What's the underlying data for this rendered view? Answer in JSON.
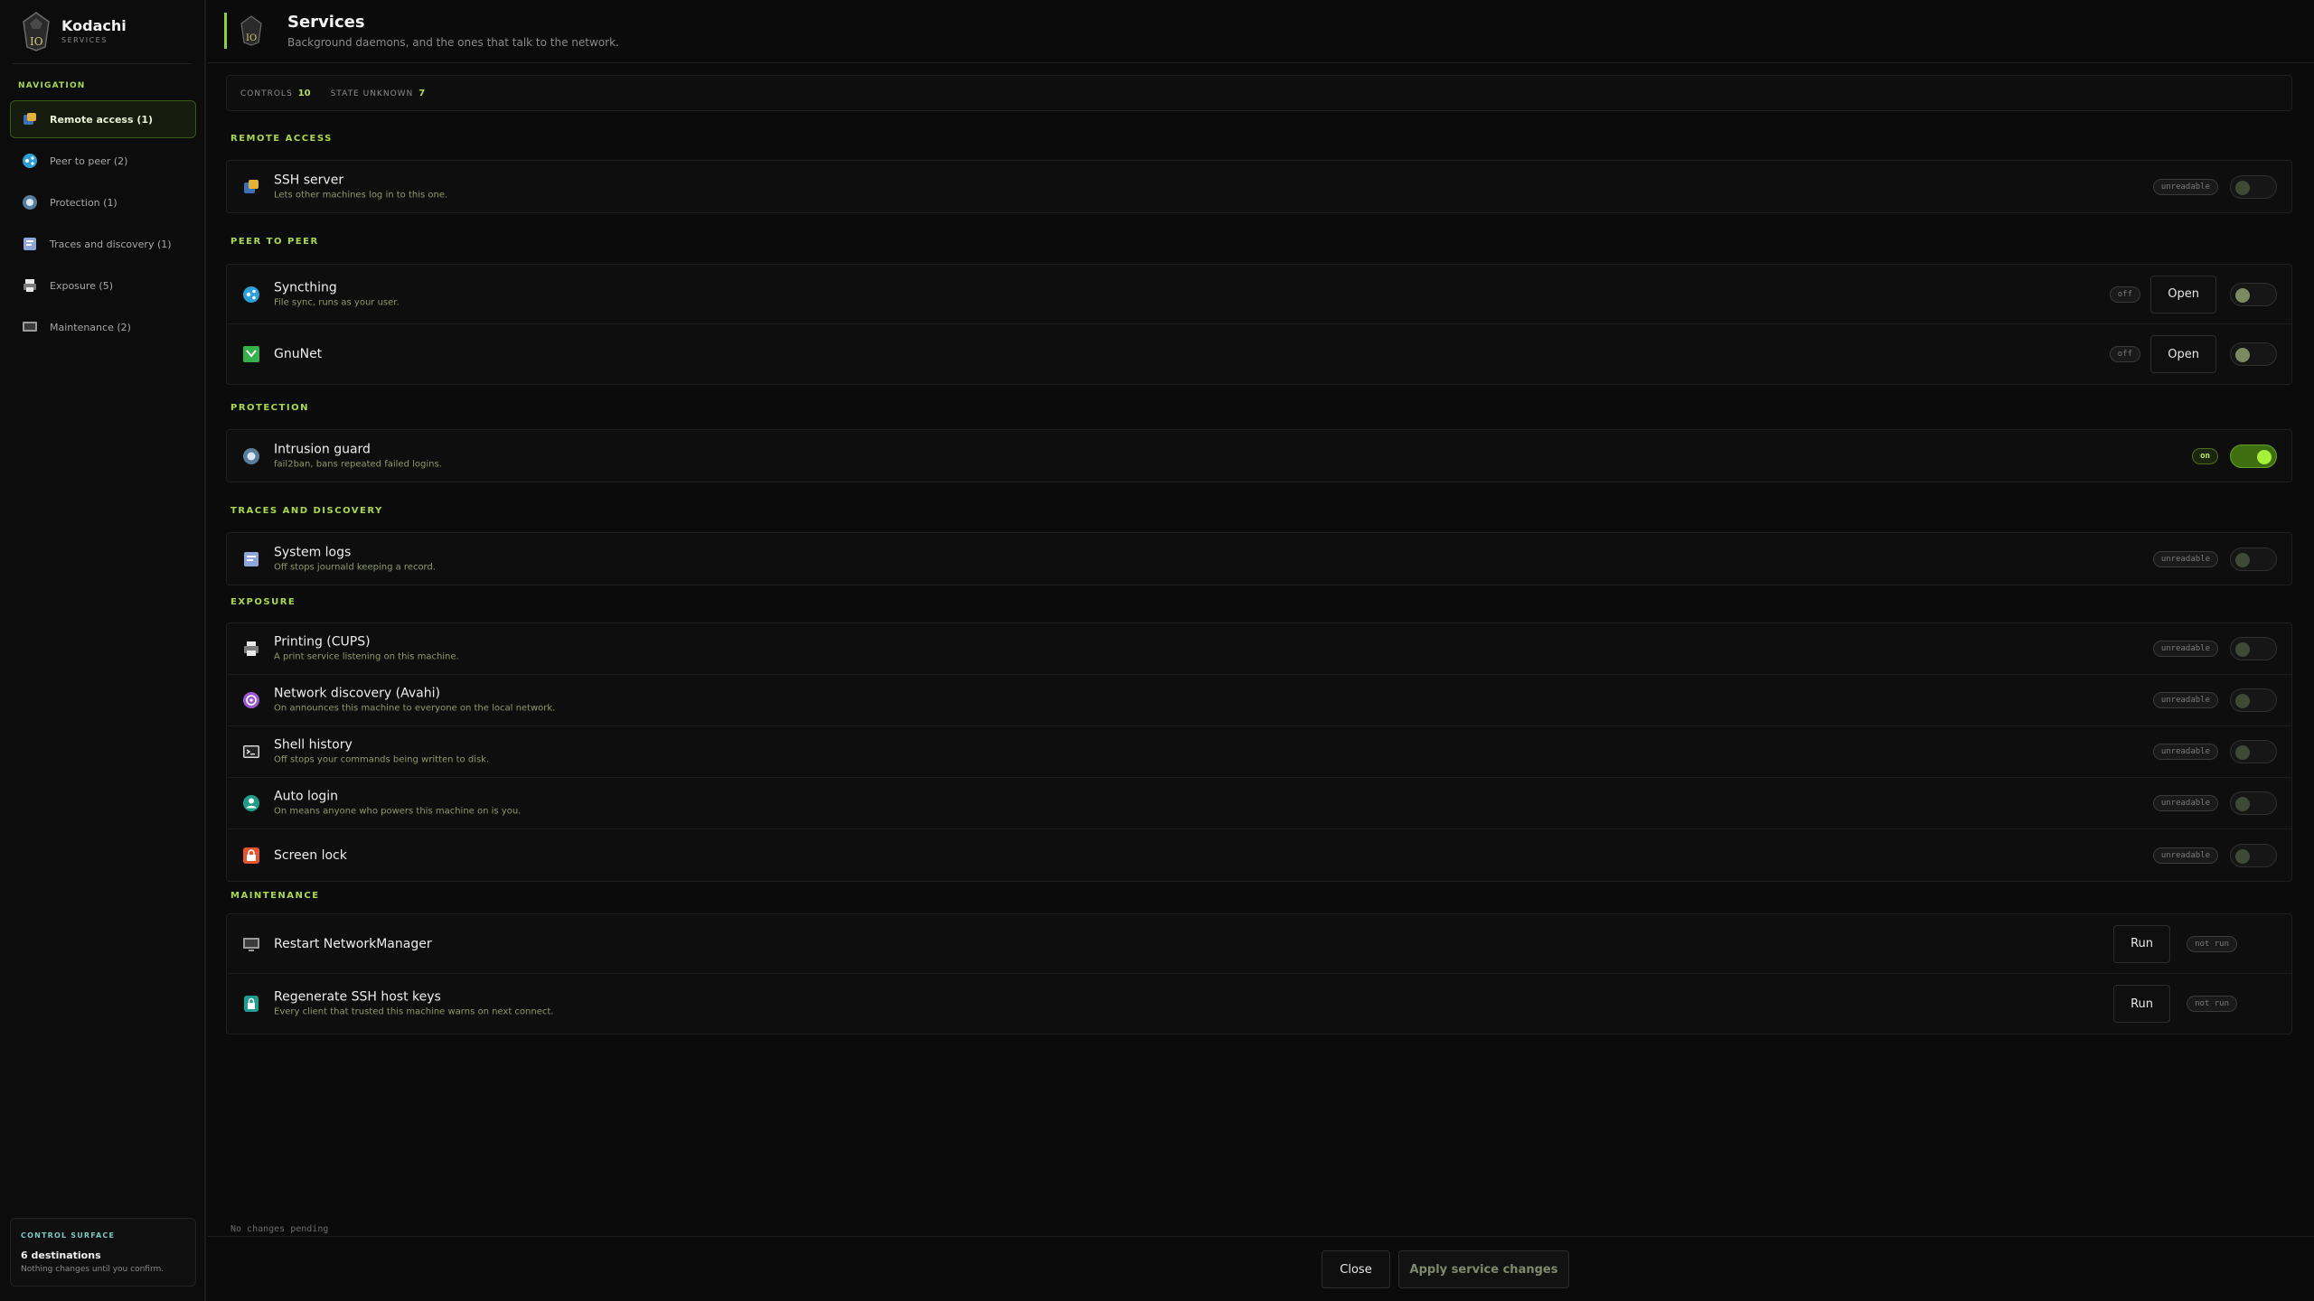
{
  "app": {
    "name": "Kodachi",
    "section": "SERVICES"
  },
  "sidebar": {
    "caption": "NAVIGATION",
    "items": [
      {
        "label": "Remote access (1)",
        "icon": "ssh-icon",
        "active": true
      },
      {
        "label": "Peer to peer (2)",
        "icon": "sync-icon"
      },
      {
        "label": "Protection (1)",
        "icon": "shield-icon"
      },
      {
        "label": "Traces and discovery (1)",
        "icon": "logs-icon"
      },
      {
        "label": "Exposure (5)",
        "icon": "printer-icon"
      },
      {
        "label": "Maintenance (2)",
        "icon": "monitor-icon"
      }
    ],
    "control": {
      "caption": "CONTROL SURFACE",
      "title": "6 destinations",
      "note": "Nothing changes until you confirm."
    }
  },
  "header": {
    "title": "Services",
    "subtitle": "Background daemons, and the ones that talk to the network."
  },
  "stats": {
    "controls_label": "CONTROLS",
    "controls_value": "10",
    "unknown_label": "STATE UNKNOWN",
    "unknown_value": "7"
  },
  "sections": {
    "remote": {
      "title": "REMOTE ACCESS",
      "rows": [
        {
          "name": "SSH server",
          "desc": "Lets other machines log in to this one.",
          "state": "unreadable"
        }
      ]
    },
    "p2p": {
      "title": "PEER TO PEER",
      "rows": [
        {
          "name": "Syncthing",
          "desc": "File sync, runs as your user.",
          "state": "off",
          "button": "Open"
        },
        {
          "name": "GnuNet",
          "state": "off",
          "button": "Open"
        }
      ]
    },
    "protection": {
      "title": "PROTECTION",
      "rows": [
        {
          "name": "Intrusion guard",
          "desc": "fail2ban, bans repeated failed logins.",
          "state": "on"
        }
      ]
    },
    "traces": {
      "title": "TRACES AND DISCOVERY",
      "rows": [
        {
          "name": "System logs",
          "desc": "Off stops journald keeping a record.",
          "state": "unreadable"
        }
      ]
    },
    "exposure": {
      "title": "EXPOSURE",
      "rows": [
        {
          "name": "Printing (CUPS)",
          "desc": "A print service listening on this machine.",
          "state": "unreadable"
        },
        {
          "name": "Network discovery (Avahi)",
          "desc": "On announces this machine to everyone on the local network.",
          "state": "unreadable"
        },
        {
          "name": "Shell history",
          "desc": "Off stops your commands being written to disk.",
          "state": "unreadable"
        },
        {
          "name": "Auto login",
          "desc": "On means anyone who powers this machine on is you.",
          "state": "unreadable"
        },
        {
          "name": "Screen lock",
          "state": "unreadable"
        }
      ]
    },
    "maintenance": {
      "title": "MAINTENANCE",
      "rows": [
        {
          "name": "Restart NetworkManager",
          "button": "Run",
          "state": "not run"
        },
        {
          "name": "Regenerate SSH host keys",
          "desc": "Every client that trusted this machine warns on next connect.",
          "button": "Run",
          "state": "not run"
        }
      ]
    }
  },
  "footer": {
    "pending": "No changes pending",
    "close_label": "Close",
    "apply_label": "Apply service changes"
  },
  "colors": {
    "accent": "#a9d94e",
    "toggle_on": "#a6f23a",
    "background": "#0b0b0b"
  }
}
